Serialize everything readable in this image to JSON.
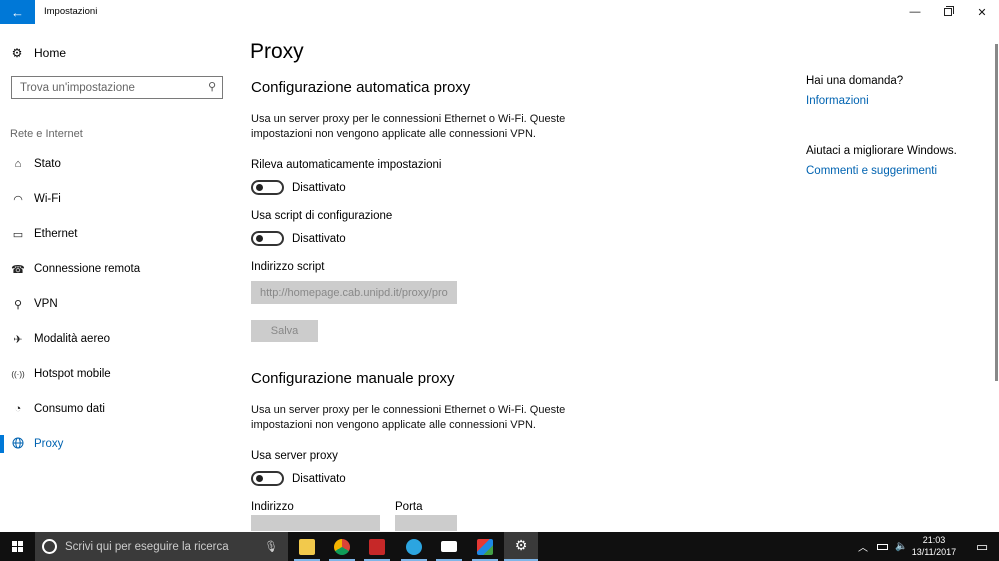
{
  "window": {
    "title": "Impostazioni",
    "back_icon": "←",
    "minimize_icon": "—",
    "close_icon": "✕"
  },
  "sidebar": {
    "home_label": "Home",
    "home_icon": "⚙",
    "search_placeholder": "Trova un'impostazione",
    "group_label": "Rete e Internet",
    "items": [
      {
        "label": "Stato",
        "icon": "⌂"
      },
      {
        "label": "Wi-Fi",
        "icon": "◠"
      },
      {
        "label": "Ethernet",
        "icon": "▭"
      },
      {
        "label": "Connessione remota",
        "icon": "☎"
      },
      {
        "label": "VPN",
        "icon": "⚲"
      },
      {
        "label": "Modalità aereo",
        "icon": "✈"
      },
      {
        "label": "Hotspot mobile",
        "icon": "((·))"
      },
      {
        "label": "Consumo dati",
        "icon": "◔"
      },
      {
        "label": "Proxy",
        "icon": "🌐"
      }
    ],
    "active_item": "Proxy"
  },
  "main": {
    "page_title": "Proxy",
    "auto": {
      "title": "Configurazione automatica proxy",
      "description": "Usa un server proxy per le connessioni Ethernet o Wi-Fi. Queste impostazioni non vengono applicate alle connessioni VPN.",
      "detect_label": "Rileva automaticamente impostazioni",
      "detect_state": "Disattivato",
      "script_label": "Usa script di configurazione",
      "script_state": "Disattivato",
      "script_address_label": "Indirizzo script",
      "script_address_value": "http://homepage.cab.unipd.it/proxy/pro",
      "save_label": "Salva"
    },
    "manual": {
      "title": "Configurazione manuale proxy",
      "description": "Usa un server proxy per le connessioni Ethernet o Wi-Fi. Queste impostazioni non vengono applicate alle connessioni VPN.",
      "use_proxy_label": "Usa server proxy",
      "use_proxy_state": "Disattivato",
      "address_label": "Indirizzo",
      "port_label": "Porta"
    }
  },
  "right": {
    "question": "Hai una domanda?",
    "info_link": "Informazioni",
    "improve": "Aiutaci a migliorare Windows.",
    "feedback_link": "Commenti e suggerimenti"
  },
  "taskbar": {
    "search_placeholder": "Scrivi qui per eseguire la ricerca",
    "mic_icon": "🎙",
    "time": "21:03",
    "date": "13/11/2017",
    "apps": [
      "file-explorer",
      "chrome",
      "red-app",
      "telegram",
      "mail",
      "colored-app",
      "settings"
    ],
    "tray_icons": [
      "chevron-up",
      "battery",
      "volume",
      "network"
    ],
    "colors": {
      "accent": "#0078d7",
      "link": "#0063b1",
      "taskbar": "#101010"
    }
  }
}
